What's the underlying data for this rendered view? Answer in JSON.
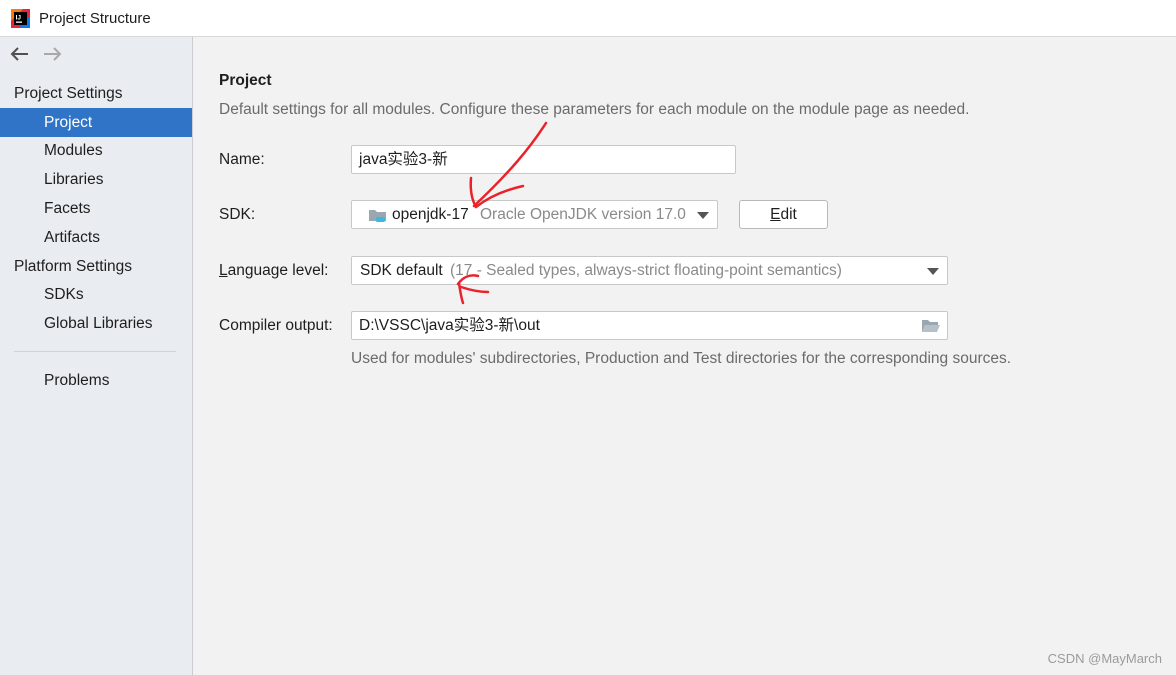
{
  "window": {
    "title": "Project Structure"
  },
  "sidebar": {
    "project_settings_header": "Project Settings",
    "project_settings_items": [
      {
        "label": "Project",
        "selected": true
      },
      {
        "label": "Modules"
      },
      {
        "label": "Libraries"
      },
      {
        "label": "Facets"
      },
      {
        "label": "Artifacts"
      }
    ],
    "platform_settings_header": "Platform Settings",
    "platform_settings_items": [
      {
        "label": "SDKs"
      },
      {
        "label": "Global Libraries"
      }
    ],
    "problems_label": "Problems"
  },
  "main": {
    "title": "Project",
    "description": "Default settings for all modules. Configure these parameters for each module on the module page as needed.",
    "name": {
      "label": "Name:",
      "value": "java实验3-新"
    },
    "sdk": {
      "label": "SDK:",
      "selected": "openjdk-17",
      "detail": "Oracle OpenJDK version 17.0",
      "edit_button": "Edit",
      "edit_mnemonic": "E",
      "edit_rest": "dit"
    },
    "language_level": {
      "label": "Language level:",
      "label_mnemonic": "L",
      "label_rest": "anguage level:",
      "selected": "SDK default",
      "detail": "(17 - Sealed types, always-strict floating-point semantics)"
    },
    "compiler_output": {
      "label": "Compiler output:",
      "value": "D:\\VSSC\\java实验3-新\\out",
      "hint": "Used for modules' subdirectories, Production and Test directories for the corresponding sources."
    }
  },
  "watermark": "CSDN @MayMarch",
  "colors": {
    "selection": "#2f74c6",
    "annotation": "#e8232a"
  },
  "icons": {
    "app": "intellij-idea-icon",
    "back": "arrow-left-icon",
    "forward": "arrow-right-icon",
    "sdk": "jdk-folder-icon",
    "browse": "folder-open-icon"
  }
}
